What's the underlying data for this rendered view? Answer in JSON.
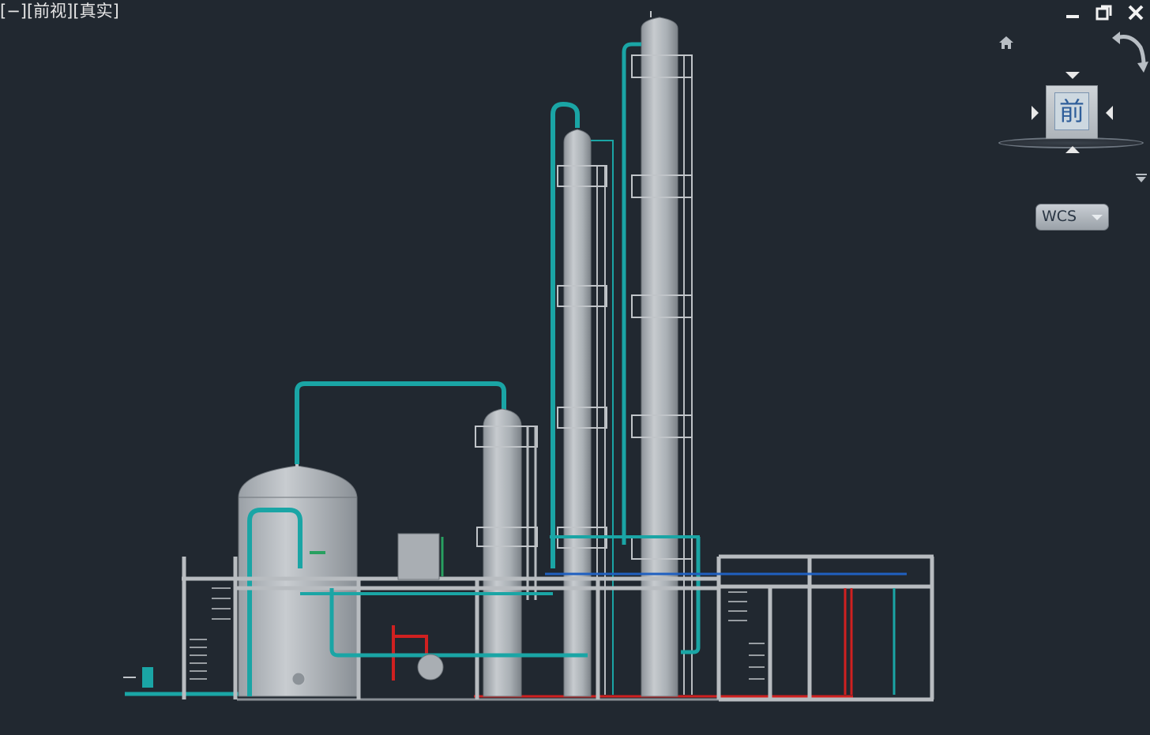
{
  "viewport": {
    "controls_label": "[−]",
    "view_label": "[前视]",
    "style_label": "[真实]"
  },
  "window_controls": [
    "minimize",
    "restore",
    "close"
  ],
  "viewcube": {
    "face_label": "前",
    "home_icon": "home-icon",
    "rotate_icon": "rotate-arrow-icon"
  },
  "ucs": {
    "label": "WCS"
  },
  "colors": {
    "background": "#212830",
    "steel": "#b8bcc0",
    "pipe_teal": "#1aa5a5",
    "pipe_red": "#d02020",
    "pipe_blue": "#2060c0",
    "pipe_green": "#28a060"
  }
}
